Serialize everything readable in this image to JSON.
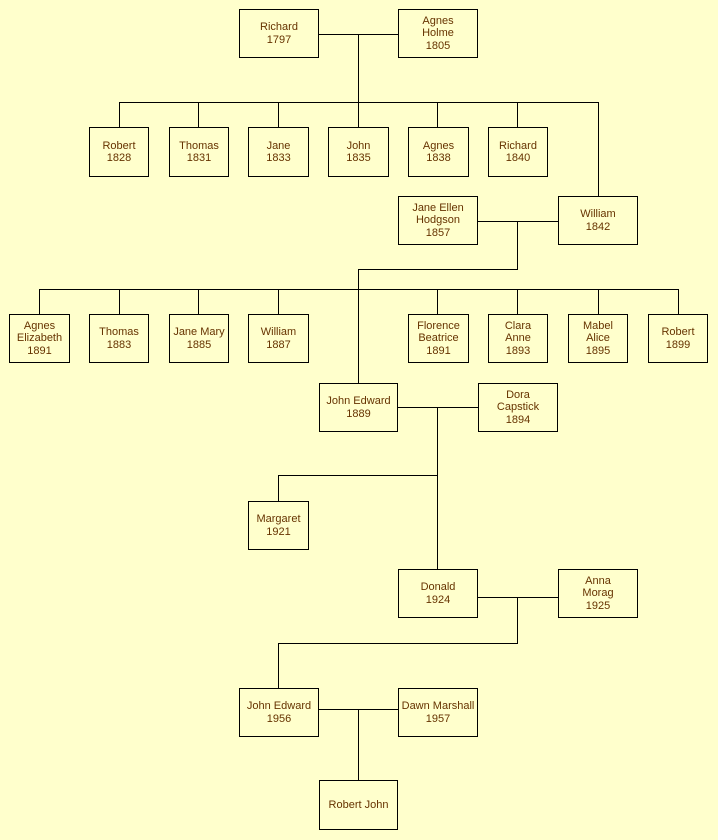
{
  "colors": {
    "background": "#FFFFCC",
    "text": "#663300",
    "lines": "#000000"
  },
  "people": {
    "richard1797": [
      "Richard",
      "1797"
    ],
    "agnesholme": [
      "Agnes",
      "Holme",
      "1805"
    ],
    "robert1828": [
      "Robert",
      "1828"
    ],
    "thomas1831": [
      "Thomas",
      "1831"
    ],
    "jane1833": [
      "Jane",
      "1833"
    ],
    "john1835": [
      "John",
      "1835"
    ],
    "agnes1838": [
      "Agnes",
      "1838"
    ],
    "richard1840": [
      "Richard",
      "1840"
    ],
    "janeellen": [
      "Jane Ellen",
      "Hodgson",
      "1857"
    ],
    "william1842": [
      "William",
      "1842"
    ],
    "agneselizabeth": [
      "Agnes",
      "Elizabeth",
      "1891"
    ],
    "thomas1883": [
      "Thomas",
      "1883"
    ],
    "janemary": [
      "Jane Mary",
      "1885"
    ],
    "william1887": [
      "William",
      "1887"
    ],
    "florence": [
      "Florence",
      "Beatrice",
      "1891"
    ],
    "clara": [
      "Clara",
      "Anne",
      "1893"
    ],
    "mabel": [
      "Mabel",
      "Alice",
      "1895"
    ],
    "robert1899": [
      "Robert",
      "1899"
    ],
    "johnedward1889": [
      "John Edward",
      "1889"
    ],
    "dora": [
      "Dora",
      "Capstick",
      "1894"
    ],
    "margaret": [
      "Margaret",
      "1921"
    ],
    "donald": [
      "Donald",
      "1924"
    ],
    "anna": [
      "Anna",
      "Morag",
      "1925"
    ],
    "johnedward1956": [
      "John Edward",
      "1956"
    ],
    "dawn": [
      "Dawn Marshall",
      "1957"
    ],
    "robertjohn": [
      "Robert John"
    ]
  }
}
